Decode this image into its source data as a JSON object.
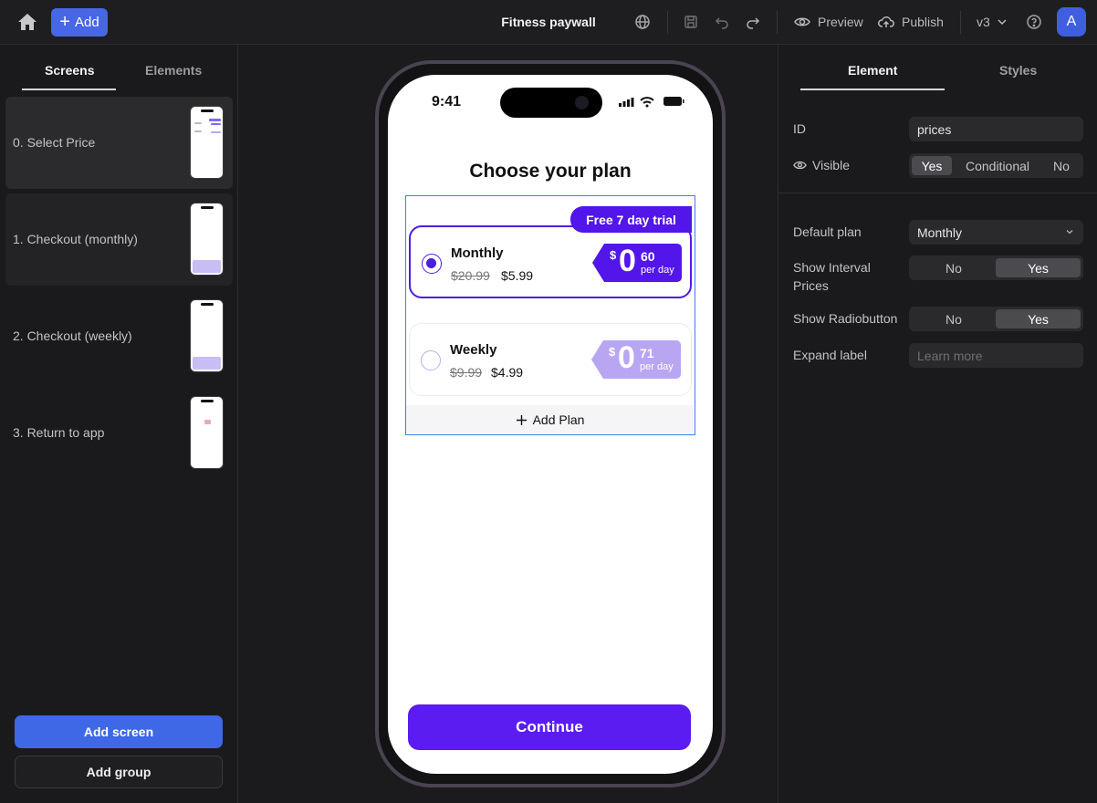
{
  "topbar": {
    "add_label": "Add",
    "title": "Fitness paywall",
    "preview_label": "Preview",
    "publish_label": "Publish",
    "version": "v3",
    "avatar_initial": "A"
  },
  "left_panel": {
    "tabs": [
      {
        "label": "Screens"
      },
      {
        "label": "Elements"
      }
    ],
    "screens": [
      {
        "label": "0.  Select Price"
      },
      {
        "label": "1.  Checkout (monthly)"
      },
      {
        "label": "2.  Checkout (weekly)"
      },
      {
        "label": "3.  Return to app"
      }
    ],
    "add_screen_label": "Add screen",
    "add_group_label": "Add group"
  },
  "phone": {
    "time": "9:41",
    "heading": "Choose your plan",
    "trial_badge": "Free 7 day trial",
    "plans": [
      {
        "name": "Monthly",
        "old_price": "$20.99",
        "price": "$5.99",
        "currency": "$",
        "whole": "0",
        "fraction": "60",
        "unit": "per day",
        "selected": true
      },
      {
        "name": "Weekly",
        "old_price": "$9.99",
        "price": "$4.99",
        "currency": "$",
        "whole": "0",
        "fraction": "71",
        "unit": "per day",
        "selected": false
      }
    ],
    "add_plan_label": "Add Plan",
    "continue_label": "Continue"
  },
  "right_panel": {
    "tabs": [
      {
        "label": "Element"
      },
      {
        "label": "Styles"
      }
    ],
    "id_label": "ID",
    "id_value": "prices",
    "visible_label": "Visible",
    "visible_options": [
      "Yes",
      "Conditional",
      "No"
    ],
    "visible_selected": "Yes",
    "default_plan_label": "Default plan",
    "default_plan_value": "Monthly",
    "show_interval_label": "Show Interval Prices",
    "show_interval_options": [
      "No",
      "Yes"
    ],
    "show_radio_label": "Show Radiobutton",
    "show_radio_options": [
      "No",
      "Yes"
    ],
    "expand_label": "Expand label",
    "expand_placeholder": "Learn more"
  },
  "colors": {
    "accent_blue": "#4867e6",
    "plan_purple": "#5215ea",
    "selection_outline": "#3b82e6",
    "unselected_tag": "#b9a6f3"
  }
}
